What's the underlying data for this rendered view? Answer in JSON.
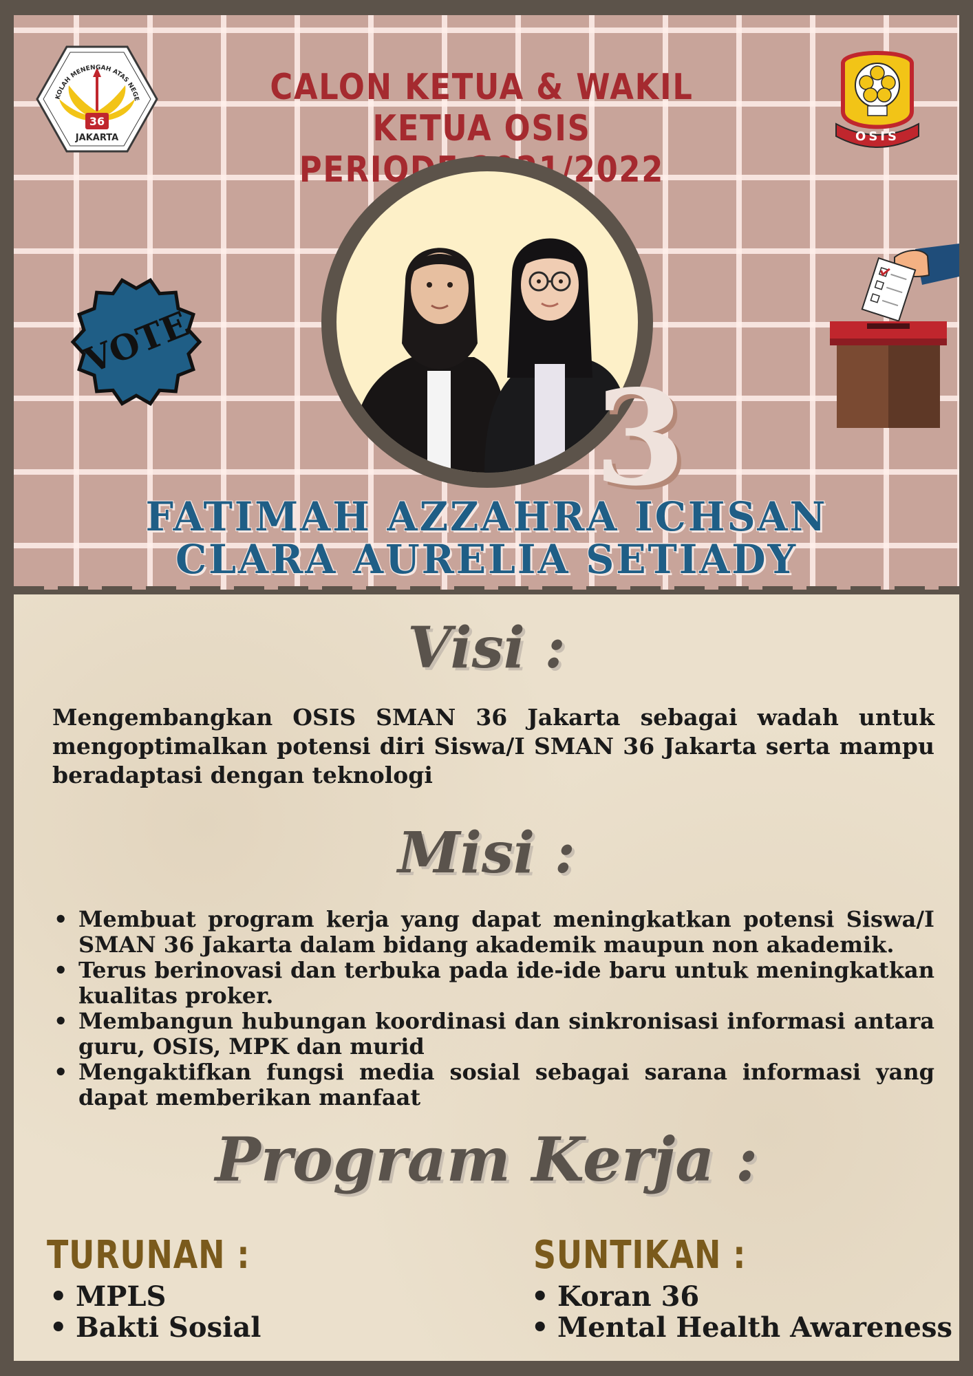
{
  "header": {
    "title_line1": "CALON KETUA & WAKIL KETUA OSIS",
    "title_line2": "PERIODE 2021/2022"
  },
  "logos": {
    "left_text_top": "SEKOLAH MENENGAH ATAS NEGERI",
    "left_number": "36",
    "left_text_bottom": "JAKARTA",
    "right_text": "OSIS"
  },
  "badge": {
    "label": "VOTE"
  },
  "candidate": {
    "number": "3",
    "name_1": "FATIMAH AZZAHRA ICHSAN",
    "name_2": "CLARA AURELIA SETIADY"
  },
  "visi": {
    "heading": "Visi :",
    "text": "Mengembangkan OSIS SMAN 36 Jakarta sebagai wadah untuk mengoptimalkan potensi diri Siswa/I SMAN 36 Jakarta serta mampu beradaptasi dengan teknologi"
  },
  "misi": {
    "heading": "Misi :",
    "items": [
      "Membuat program kerja yang dapat meningkatkan potensi Siswa/I SMAN 36 Jakarta dalam bidang akademik maupun non akademik.",
      "Terus berinovasi dan terbuka pada ide-ide baru untuk meningkatkan kualitas proker.",
      "Membangun hubungan koordinasi dan sinkronisasi informasi antara guru, OSIS, MPK dan murid",
      "Mengaktifkan fungsi media sosial sebagai sarana informasi yang dapat memberikan manfaat"
    ]
  },
  "program_kerja": {
    "heading": "Program Kerja :",
    "turunan": {
      "heading": "TURUNAN :",
      "items": [
        "MPLS",
        "Bakti Sosial"
      ]
    },
    "suntikan": {
      "heading": "SUNTIKAN :",
      "items": [
        "Koran 36",
        "Mental Health Awareness"
      ]
    }
  },
  "colors": {
    "frame": "#5c534a",
    "grid_bg": "#c8a49a",
    "title_red": "#a52a2f",
    "name_blue": "#1f5e86",
    "paper": "#ebe0cc",
    "subheading_brown": "#7a5a1c"
  }
}
